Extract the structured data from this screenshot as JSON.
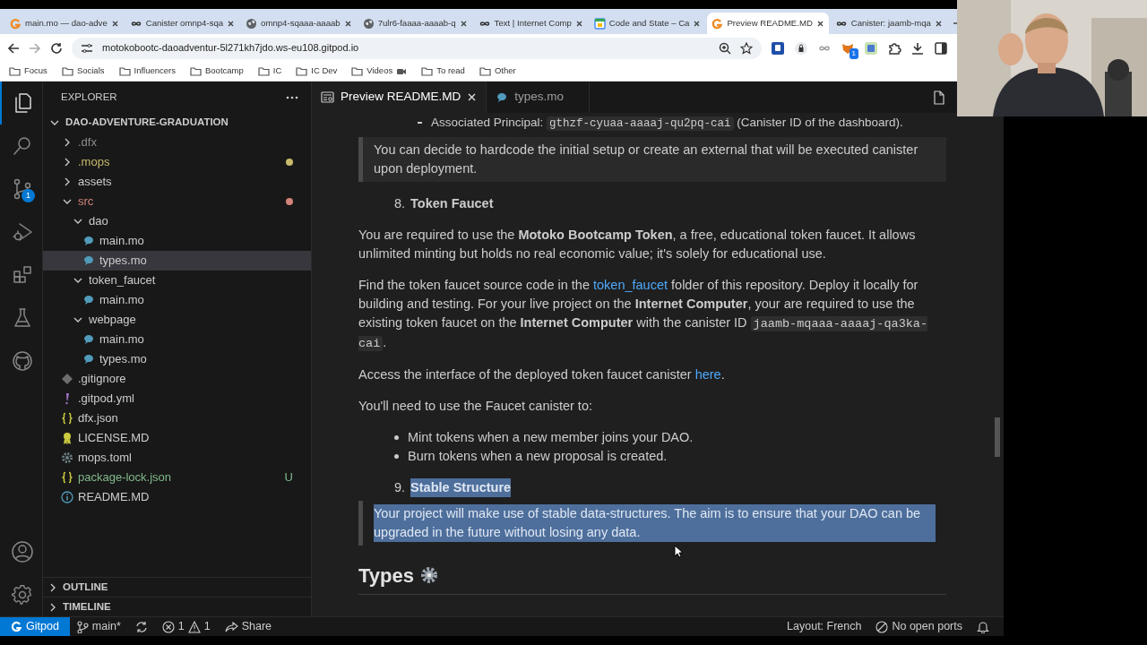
{
  "browser": {
    "tabs": [
      {
        "title": "main.mo — dao-adve",
        "kind": "gitpod",
        "selected": false
      },
      {
        "title": "Canister omnp4-sqa",
        "kind": "infinity",
        "selected": false
      },
      {
        "title": "omnp4-sqaaa-aaaab",
        "kind": "globe",
        "selected": false
      },
      {
        "title": "7ulr6-faaaa-aaaab-q",
        "kind": "globe",
        "selected": false
      },
      {
        "title": "Text | Internet Comp",
        "kind": "infinity",
        "selected": false
      },
      {
        "title": "Code and State – Ca",
        "kind": "calendar",
        "selected": false
      },
      {
        "title": "Preview README.MD",
        "kind": "gitpod",
        "selected": true
      },
      {
        "title": "Canister: jaamb-mqa",
        "kind": "infinity",
        "selected": false
      }
    ],
    "address": "motokobootc-daoadventur-5l271kh7jdo.ws-eu108.gitpod.io",
    "extensions": [
      {
        "kind": "square-blue"
      },
      {
        "kind": "lock"
      },
      {
        "kind": "infinity"
      },
      {
        "kind": "fox",
        "badge": "1"
      },
      {
        "kind": "square-green"
      },
      {
        "kind": "puzzle"
      }
    ],
    "bookmarks": [
      {
        "label": "Focus"
      },
      {
        "label": "Socials"
      },
      {
        "label": "Influencers"
      },
      {
        "label": "Bootcamp"
      },
      {
        "label": "IC"
      },
      {
        "label": "IC Dev"
      },
      {
        "label": "Videos",
        "camera": true
      },
      {
        "label": "To read"
      },
      {
        "label": "Other"
      }
    ]
  },
  "activity_bar": {
    "items": [
      {
        "kind": "explorer",
        "selected": true
      },
      {
        "kind": "search",
        "selected": false
      },
      {
        "kind": "source-control",
        "selected": false,
        "badge": "1"
      },
      {
        "kind": "run",
        "selected": false
      },
      {
        "kind": "extensions",
        "selected": false
      },
      {
        "kind": "testing",
        "selected": false
      },
      {
        "kind": "github",
        "selected": false
      }
    ],
    "bottom": [
      {
        "kind": "account"
      },
      {
        "kind": "settings"
      }
    ]
  },
  "sidebar": {
    "title": "EXPLORER",
    "project": "DAO-ADVENTURE-GRADUATION",
    "tree": [
      {
        "label": ".dfx",
        "kind": "folder",
        "expanded": false,
        "color": "#8c8c8c",
        "selected": false
      },
      {
        "label": ".mops",
        "kind": "folder",
        "expanded": false,
        "color": "#c9b96c",
        "dot": true,
        "selected": false
      },
      {
        "label": "assets",
        "kind": "folder",
        "expanded": false,
        "selected": false
      },
      {
        "label": "src",
        "kind": "folder",
        "expanded": true,
        "color": "#d3837a",
        "dot": true,
        "selected": false,
        "children": [
          {
            "label": "dao",
            "kind": "folder",
            "expanded": true,
            "selected": false,
            "children": [
              {
                "label": "main.mo",
                "kind": "motoko",
                "selected": false
              },
              {
                "label": "types.mo",
                "kind": "motoko",
                "selected": true
              }
            ]
          },
          {
            "label": "token_faucet",
            "kind": "folder",
            "expanded": true,
            "selected": false,
            "children": [
              {
                "label": "main.mo",
                "kind": "motoko",
                "selected": false
              }
            ]
          },
          {
            "label": "webpage",
            "kind": "folder",
            "expanded": true,
            "selected": false,
            "children": [
              {
                "label": "main.mo",
                "kind": "motoko",
                "selected": false
              },
              {
                "label": "types.mo",
                "kind": "motoko",
                "selected": false
              }
            ]
          }
        ]
      },
      {
        "label": ".gitignore",
        "kind": "git",
        "selected": false
      },
      {
        "label": ".gitpod.yml",
        "kind": "yaml",
        "selected": false
      },
      {
        "label": "dfx.json",
        "kind": "json",
        "selected": false
      },
      {
        "label": "LICENSE.MD",
        "kind": "license",
        "selected": false
      },
      {
        "label": "mops.toml",
        "kind": "toml",
        "selected": false
      },
      {
        "label": "package-lock.json",
        "kind": "json",
        "color": "#81b88b",
        "badge": "U",
        "selected": false
      },
      {
        "label": "README.MD",
        "kind": "info",
        "selected": false
      }
    ],
    "panels": [
      {
        "label": "OUTLINE",
        "expanded": false
      },
      {
        "label": "TIMELINE",
        "expanded": false
      }
    ]
  },
  "editor": {
    "tabs": [
      {
        "label": "Preview README.MD",
        "kind": "preview",
        "selected": true
      },
      {
        "label": "types.mo",
        "kind": "motoko",
        "selected": false
      }
    ],
    "blocks": [
      {
        "kind": "bullet",
        "parts": [
          {
            "kind": "text",
            "text": "Associated Principal: "
          },
          {
            "kind": "code",
            "text": "gthzf-cyuaa-aaaaj-qu2pq-cai"
          },
          {
            "kind": "text",
            "text": " (Canister ID of the dashboard)."
          }
        ]
      },
      {
        "kind": "quote",
        "highlighted": false,
        "text": "You can decide to hardcode the initial setup or create an external that will be executed canister upon deployment."
      },
      {
        "kind": "numbered",
        "number": "8.",
        "text": "Token Faucet",
        "highlighted": false
      },
      {
        "kind": "paragraph",
        "parts": [
          {
            "kind": "text",
            "text": "You are required to use the "
          },
          {
            "kind": "bold",
            "text": "Motoko Bootcamp Token"
          },
          {
            "kind": "text",
            "text": ", a free, educational token faucet. It allows unlimited minting but holds no real economic value; it's solely for educational use."
          }
        ]
      },
      {
        "kind": "paragraph",
        "parts": [
          {
            "kind": "text",
            "text": "Find the token faucet source code in the "
          },
          {
            "kind": "link",
            "text": "token_faucet"
          },
          {
            "kind": "text",
            "text": " folder of this repository. Deploy it locally for building and testing. For your live project on the "
          },
          {
            "kind": "bold",
            "text": "Internet Computer"
          },
          {
            "kind": "text",
            "text": ", your are required to use the existing token faucet on the "
          },
          {
            "kind": "bold",
            "text": "Internet Computer"
          },
          {
            "kind": "text",
            "text": " with the canister ID "
          },
          {
            "kind": "code",
            "text": "jaamb-mqaaa-aaaaj-qa3ka-cai"
          },
          {
            "kind": "text",
            "text": "."
          }
        ]
      },
      {
        "kind": "paragraph",
        "parts": [
          {
            "kind": "text",
            "text": "Access the interface of the deployed token faucet canister "
          },
          {
            "kind": "link",
            "text": "here"
          },
          {
            "kind": "text",
            "text": "."
          }
        ]
      },
      {
        "kind": "paragraph",
        "parts": [
          {
            "kind": "text",
            "text": "You'll need to use the Faucet canister to:"
          }
        ]
      },
      {
        "kind": "list",
        "items": [
          "Mint tokens when a new member joins your DAO.",
          "Burn tokens when a new proposal is created."
        ]
      },
      {
        "kind": "numbered",
        "number": "9.",
        "text": "Stable Structure",
        "highlighted": true
      },
      {
        "kind": "quote",
        "highlighted": true,
        "text": "Your project will make use of stable data-structures. The aim is to ensure that your DAO can be upgraded in the future without losing any data."
      },
      {
        "kind": "heading",
        "text": "Types",
        "gear": true
      }
    ]
  },
  "status_bar": {
    "remote": "Gitpod",
    "branch": "main*",
    "errors": "1",
    "warnings": "1",
    "share": "Share",
    "layout": "Layout: French",
    "ports": "No open ports"
  }
}
